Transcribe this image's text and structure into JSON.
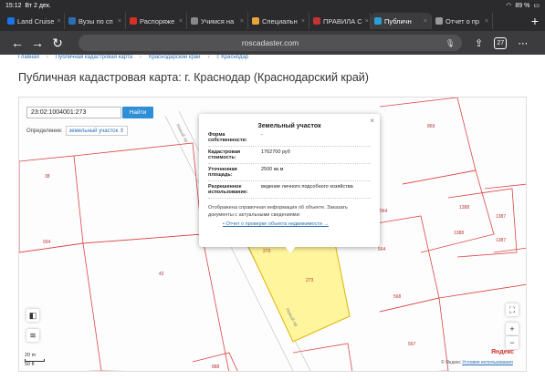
{
  "status": {
    "time": "15:12",
    "date": "Вт 2 дек.",
    "battery": "89 %"
  },
  "tabs": [
    {
      "label": "Land Cruise",
      "color": "#1a73e8"
    },
    {
      "label": "Вузы по сп",
      "color": "#2a6fb5"
    },
    {
      "label": "Распоряже",
      "color": "#d93025"
    },
    {
      "label": "Учимся на",
      "color": "#888888"
    },
    {
      "label": "Специальн",
      "color": "#e8a33d"
    },
    {
      "label": "ПРАВИЛА С",
      "color": "#c33333"
    },
    {
      "label": "Публичн",
      "color": "#2a9fd6",
      "active": true
    },
    {
      "label": "Отчет о пр",
      "color": "#999999"
    }
  ],
  "browser": {
    "url": "roscadaster.com",
    "tab_count": "27"
  },
  "breadcrumbs": [
    "Главная",
    "Публичная кадастровая карта",
    "Краснодарский край",
    "г. Краснодар"
  ],
  "page_title": "Публичная кадастровая карта: г. Краснодар (Краснодарский край)",
  "map": {
    "search_value": "23:02:1004001:273",
    "search_button": "Найти",
    "definition_label": "Определение:",
    "definition_value": "земельный участок",
    "scale_m": "20 m",
    "scale_ft": "50 ft",
    "provider": "Яндекс",
    "copyright": "© Яндекс",
    "terms_link": "Условия использования",
    "street_labels": [
      "Новый пр",
      "Новый пр"
    ],
    "parcel_numbers": [
      "869",
      "38",
      "934",
      "42",
      "564",
      "564",
      "1388",
      "1387",
      "1388",
      "1387",
      "568",
      "567",
      "273",
      "273",
      "888"
    ]
  },
  "popup": {
    "title": "Земельный участок",
    "rows": [
      {
        "key": "Форма собственности:",
        "value": "-"
      },
      {
        "key": "Кадастровая стоимость:",
        "value": "1762700 руб"
      },
      {
        "key": "Уточненная площадь:",
        "value": "2500 кв.м"
      },
      {
        "key": "Разрешенное использование:",
        "value": "ведение личного подсобного хозяйства"
      }
    ],
    "note": "Отображена справочная информация об объекте. Заказать документы с актуальными сведениями:",
    "link": "Отчет о проверке объекта недвижимости →"
  }
}
